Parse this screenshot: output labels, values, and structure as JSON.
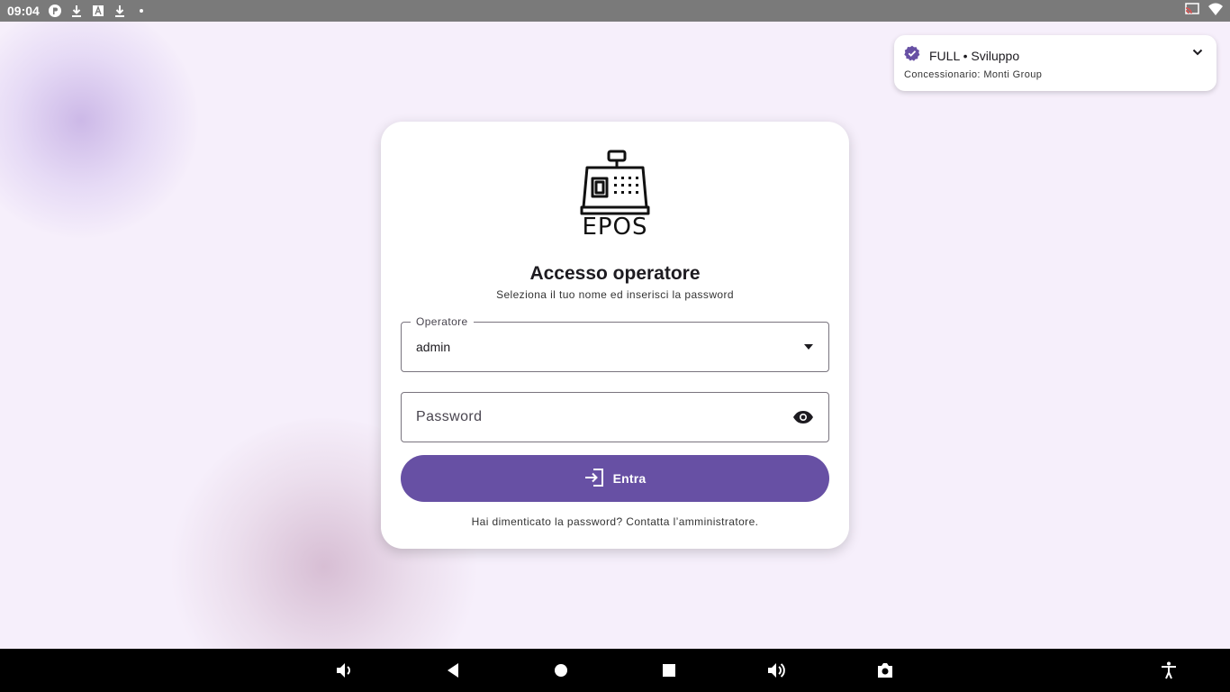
{
  "status_bar": {
    "time": "09:04",
    "notification_icons": [
      "app-icon",
      "download-icon",
      "font-app-icon",
      "download-icon",
      "dot-icon"
    ],
    "right_icons": [
      "cast-icon",
      "wifi-icon"
    ]
  },
  "login": {
    "logo_text": "EPOS",
    "title": "Accesso operatore",
    "subtitle": "Seleziona il tuo nome ed inserisci la password",
    "operator": {
      "label": "Operatore",
      "value": "admin"
    },
    "password": {
      "placeholder": "Password"
    },
    "submit_label": "Entra",
    "help_text": "Hai dimenticato la password? Contatta l’amministratore."
  },
  "license_badge": {
    "edition": "FULL • Sviluppo",
    "dealer": "Concessionario: Monti Group"
  },
  "colors": {
    "primary": "#6750a4",
    "background": "#f6effb",
    "status_bar": "#7a7a7a",
    "nav_bar": "#000000"
  },
  "nav_bar": [
    "volume-down-icon",
    "back-icon",
    "home-icon",
    "recents-icon",
    "volume-up-icon",
    "screenshot-icon",
    "accessibility-icon"
  ]
}
